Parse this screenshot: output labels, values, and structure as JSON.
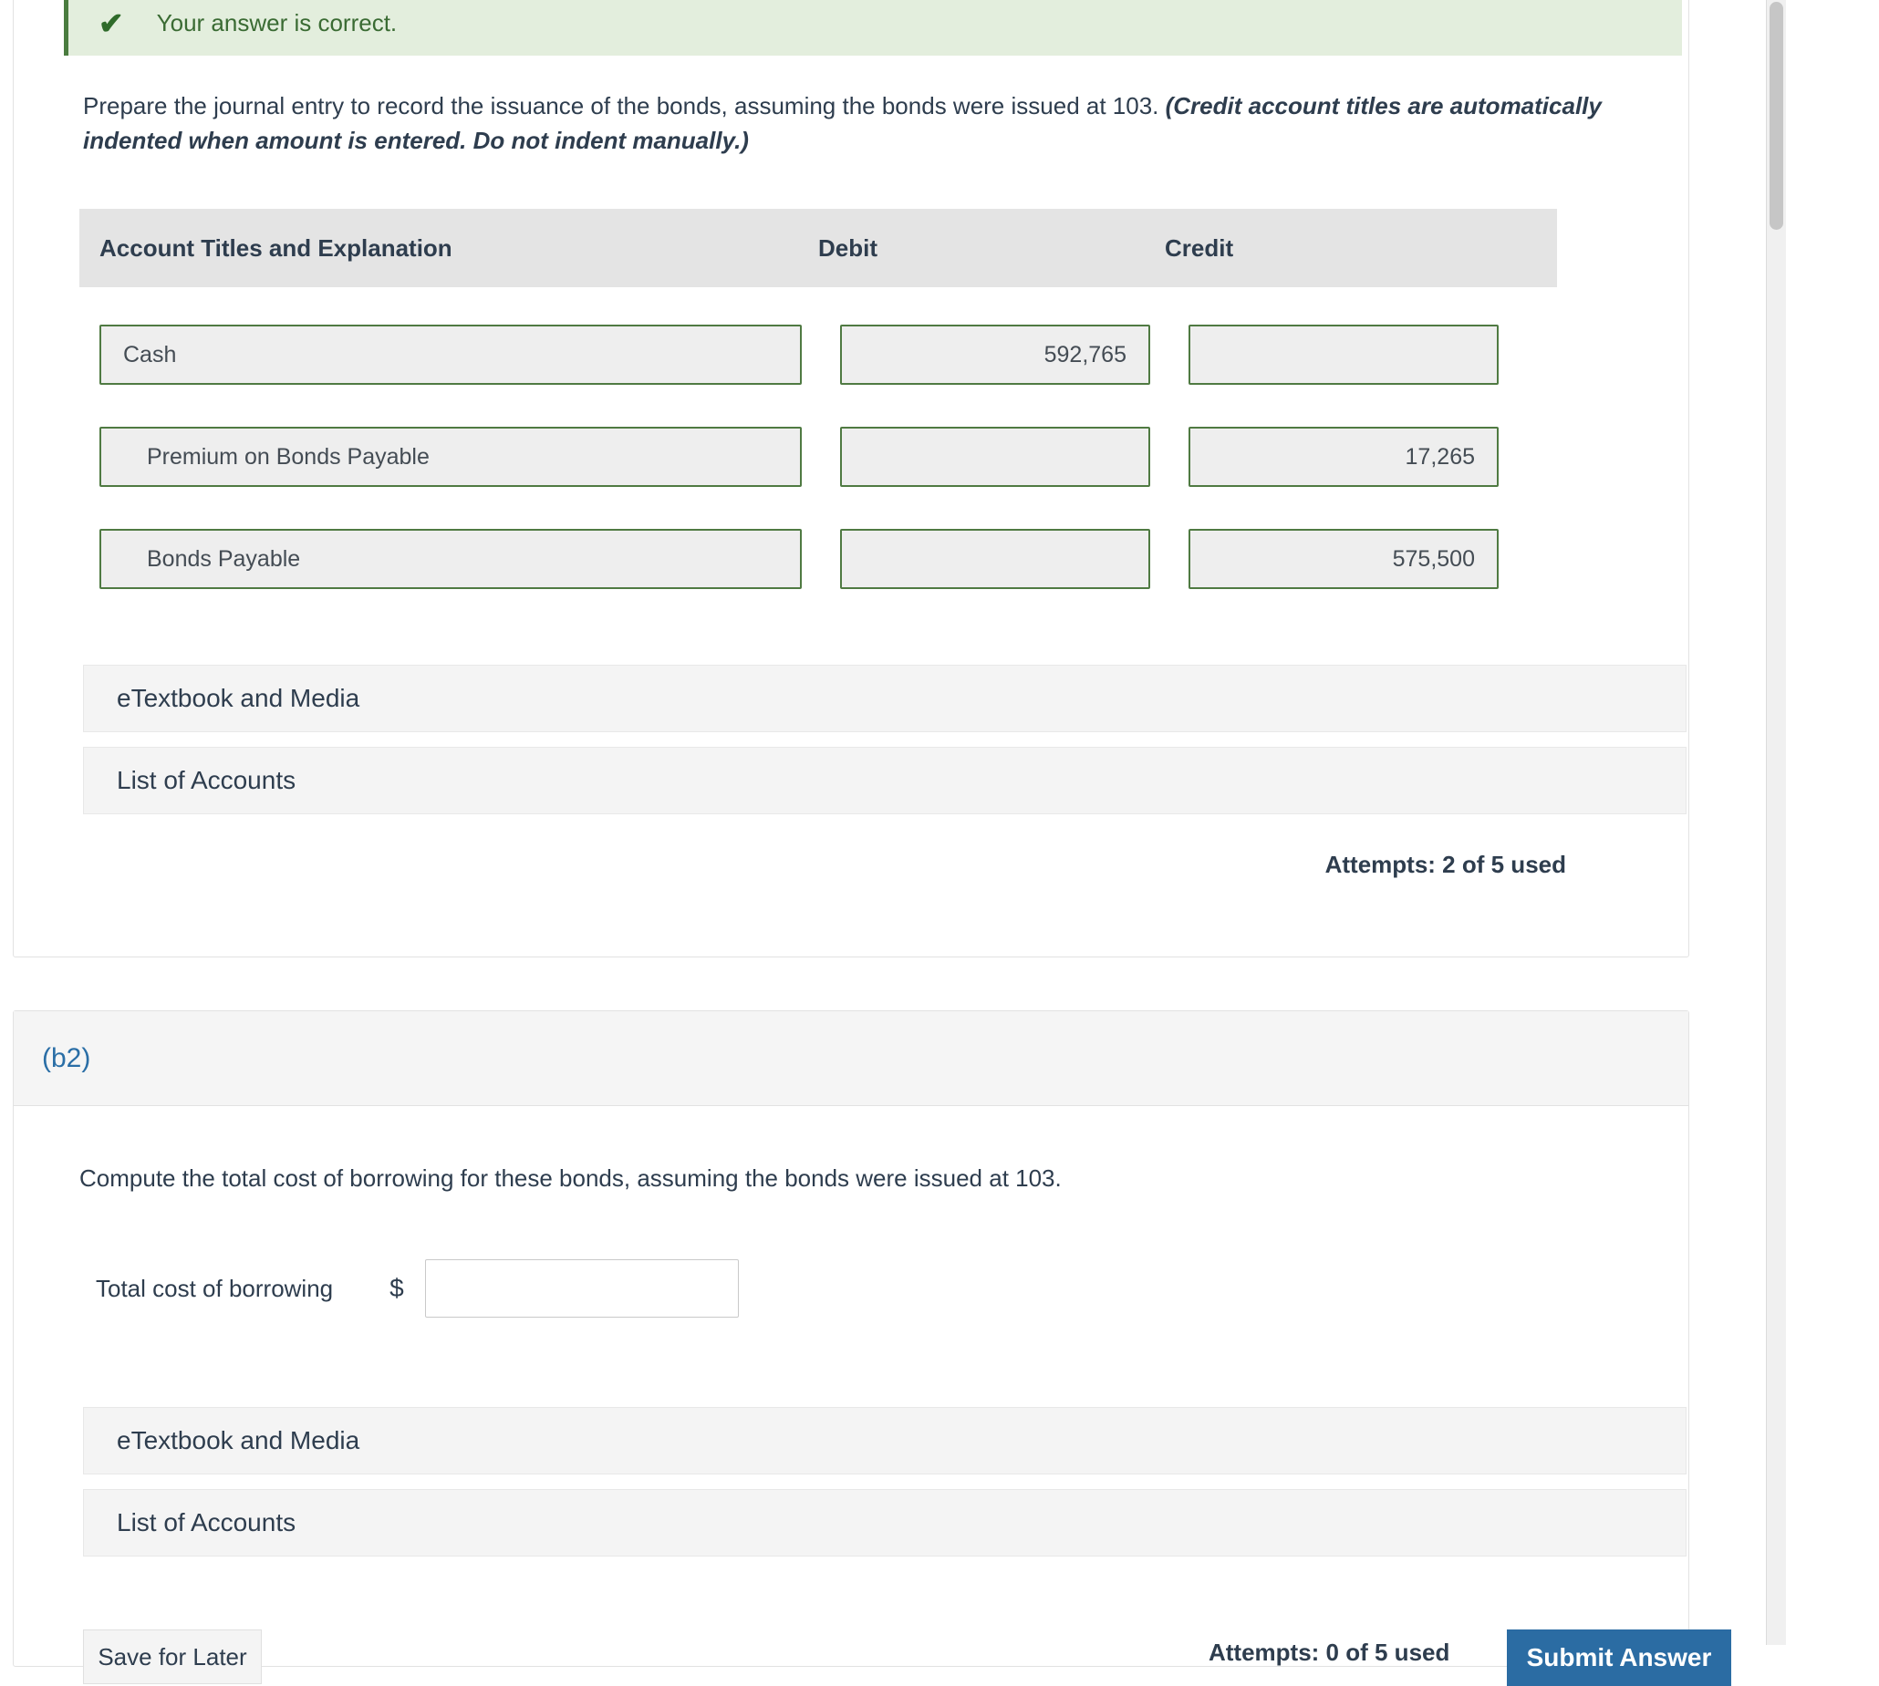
{
  "banner": {
    "icon": "check-icon",
    "text": "Your answer is correct."
  },
  "part_b1": {
    "question_main": "Prepare the journal entry to record the issuance of the bonds, assuming the bonds were issued at 103. ",
    "question_italic": "(Credit account titles are automatically indented when amount is entered. Do not indent manually.)",
    "table": {
      "headers": {
        "account": "Account Titles and Explanation",
        "debit": "Debit",
        "credit": "Credit"
      },
      "rows": [
        {
          "account": "Cash",
          "indent": false,
          "debit": "592,765",
          "credit": ""
        },
        {
          "account": "Premium on Bonds Payable",
          "indent": true,
          "debit": "",
          "credit": "17,265"
        },
        {
          "account": "Bonds Payable",
          "indent": true,
          "debit": "",
          "credit": "575,500"
        }
      ]
    },
    "etextbook_label": "eTextbook and Media",
    "list_of_accounts_label": "List of Accounts",
    "attempts": "Attempts: 2 of 5 used"
  },
  "part_b2": {
    "section_label": "(b2)",
    "question": "Compute the total cost of borrowing for these bonds, assuming the bonds were issued at 103.",
    "total_cost_label": "Total cost of borrowing",
    "currency_symbol": "$",
    "total_cost_value": "",
    "etextbook_label": "eTextbook and Media",
    "list_of_accounts_label": "List of Accounts",
    "attempts": "Attempts: 0 of 5 used",
    "submit_label": "Submit Answer",
    "save_progress_label": "Save for Later"
  },
  "colors": {
    "accent_blue": "#2b6ca3",
    "success_green": "#4a7c3f",
    "banner_bg": "#e3eedd",
    "field_border": "#4f7a42",
    "text": "#2e3d4e"
  }
}
